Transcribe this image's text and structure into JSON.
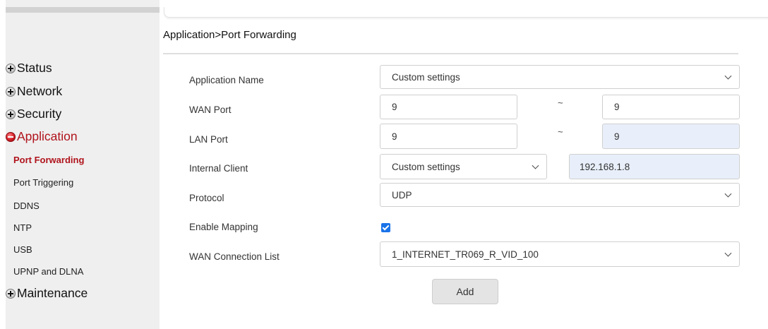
{
  "sidebar": {
    "groups": [
      {
        "label": "Status",
        "icon": "plus-icon"
      },
      {
        "label": "Network",
        "icon": "plus-icon"
      },
      {
        "label": "Security",
        "icon": "plus-icon"
      },
      {
        "label": "Application",
        "icon": "minus-icon",
        "active": true
      },
      {
        "label": "Maintenance",
        "icon": "plus-icon"
      }
    ],
    "sub_items": [
      {
        "label": "Port Forwarding",
        "active": true
      },
      {
        "label": "Port Triggering"
      },
      {
        "label": "DDNS"
      },
      {
        "label": "NTP"
      },
      {
        "label": "USB"
      },
      {
        "label": "UPNP and DLNA"
      }
    ]
  },
  "breadcrumb": "Application>Port Forwarding",
  "form": {
    "application_name": {
      "label": "Application Name",
      "value": "Custom settings"
    },
    "wan_port": {
      "label": "WAN Port",
      "start": "9",
      "separator": "~",
      "end": "9"
    },
    "lan_port": {
      "label": "LAN Port",
      "start": "9",
      "separator": "~",
      "end": "9"
    },
    "internal_client": {
      "label": "Internal Client",
      "select_value": "Custom settings",
      "ip": "192.168.1.8"
    },
    "protocol": {
      "label": "Protocol",
      "value": "UDP"
    },
    "enable_mapping": {
      "label": "Enable Mapping",
      "checked": true
    },
    "wan_connection_list": {
      "label": "WAN Connection List",
      "value": "1_INTERNET_TR069_R_VID_100"
    },
    "add_button": "Add"
  },
  "colors": {
    "accent": "#b0131c",
    "checkbox": "#1a73e8",
    "autofill": "#e8effa"
  }
}
